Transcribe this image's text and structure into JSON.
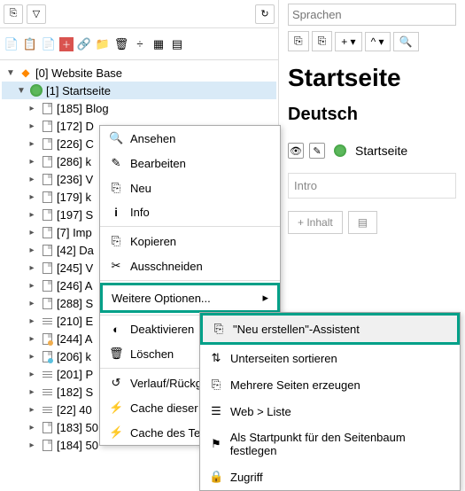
{
  "search": {
    "placeholder": "Sprachen"
  },
  "tree": {
    "root": "[0] Website Base",
    "start": "[1] Startseite",
    "items": [
      "[185] Blog",
      "[172] D",
      "[226] C",
      "[286] k",
      "[236] V",
      "[179] k",
      "[197] S",
      "[7] Imp",
      "[42] Da",
      "[245] V",
      "[246] A",
      "[288] S",
      "[210] E",
      "[244] A",
      "[206] k",
      "[201] P",
      "[182] S",
      "[22] 40",
      "[183] 50",
      "[184] 50"
    ]
  },
  "ctx": {
    "view": "Ansehen",
    "edit": "Bearbeiten",
    "new": "Neu",
    "info": "Info",
    "copy": "Kopieren",
    "cut": "Ausschneiden",
    "more": "Weitere Optionen...",
    "disable": "Deaktivieren",
    "delete": "Löschen",
    "history": "Verlauf/Rückgä",
    "cache1": "Cache dieser S",
    "cache2": "Cache des Teilb"
  },
  "sub": {
    "wizard": "\"Neu erstellen\"-Assistent",
    "sort": "Unterseiten sortieren",
    "multi": "Mehrere Seiten erzeugen",
    "list": "Web > Liste",
    "mount": "Als Startpunkt für den Seitenbaum festlegen",
    "access": "Zugriff"
  },
  "page": {
    "title": "Startseite",
    "lang": "Deutsch",
    "name": "Startseite",
    "intro": "Intro",
    "add": "Inhalt"
  }
}
